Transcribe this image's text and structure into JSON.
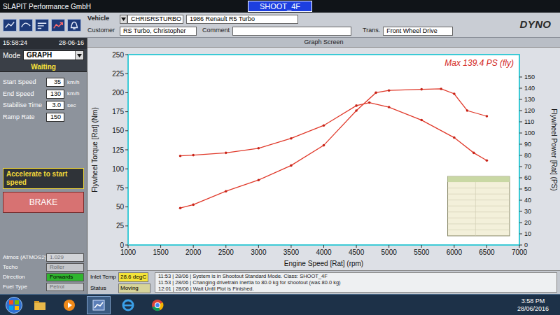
{
  "app": {
    "company": "SLAPIT Performance GmbH",
    "test": "SHOOT_4F",
    "logo": "DYNO"
  },
  "vehicle": {
    "vehicle_label": "Vehicle",
    "vehicle_id": "CHRISRSTURBO",
    "vehicle_name": "1986 Renault R5 Turbo",
    "customer_label": "Customer",
    "customer": "RS Turbo, Christopher",
    "comment_label": "Comment",
    "trans_label": "Trans.",
    "trans": "Front Wheel Drive"
  },
  "control": {
    "time": "15:58:24",
    "date": "28-06-16",
    "mode_label": "Mode",
    "mode": "GRAPH",
    "state": "Waiting",
    "settings": [
      {
        "label": "Start Speed",
        "value": "35",
        "unit": "km/h"
      },
      {
        "label": "End Speed",
        "value": "130",
        "unit": "km/h"
      },
      {
        "label": "Stabilise Time",
        "value": "3.0",
        "unit": "sec"
      },
      {
        "label": "Ramp Rate",
        "value": "150",
        "unit": ""
      }
    ],
    "prompt": "Accelerate to start speed",
    "brake": "BRAKE",
    "info": [
      {
        "label": "Atmos (ATMOS2)",
        "value": "1.029",
        "color": "#d2d4d8"
      },
      {
        "label": "Techo",
        "value": "Roller",
        "color": "#c4c6ca"
      },
      {
        "label": "Direction",
        "value": "Forwards",
        "color": "#2fb52f"
      },
      {
        "label": "Fuel Type",
        "value": "Petrol",
        "color": "#c4c6ca"
      }
    ]
  },
  "chart": {
    "title": "Graph Screen",
    "y_left_title": "Flywheel Torque [Rat] (Nm)",
    "y_right_title": "Flywheel Power [Rat] (PS)",
    "x_title": "Engine Speed [Rat] (rpm)",
    "annotation": "Max 139.4 PS (fly)",
    "x_ticks": [
      "1000",
      "1500",
      "2000",
      "2500",
      "3000",
      "3500",
      "4000",
      "4500",
      "5000",
      "5500",
      "6000",
      "6500",
      "7000"
    ],
    "y_left_ticks": [
      "0",
      "25",
      "50",
      "75",
      "100",
      "125",
      "150",
      "175",
      "200",
      "225",
      "250"
    ],
    "y_right_ticks": [
      "0",
      "10",
      "20",
      "30",
      "40",
      "50",
      "60",
      "70",
      "80",
      "90",
      "100",
      "110",
      "120",
      "130",
      "140",
      "150"
    ],
    "series": [
      {
        "axis": "left",
        "rpm": [
          1800,
          2000,
          2500,
          3000,
          3500,
          4000,
          4500,
          4700,
          5000,
          5500,
          6000,
          6300,
          6500
        ],
        "values": [
          117,
          118,
          121,
          127,
          140,
          157,
          183,
          187,
          181,
          164,
          141,
          121,
          111
        ]
      },
      {
        "axis": "right",
        "rpm": [
          1800,
          2000,
          2500,
          3000,
          3500,
          4000,
          4500,
          4800,
          5000,
          5500,
          5800,
          6000,
          6200,
          6500
        ],
        "values": [
          33,
          36,
          48,
          58,
          71,
          89,
          120,
          136,
          138,
          139,
          139.4,
          135,
          120,
          115
        ]
      }
    ]
  },
  "status": {
    "inlet_label": "Inlet Temp",
    "inlet_value": "28.6 degC",
    "status_label": "Status",
    "status_value": "Moving",
    "log": [
      "11:53 | 28/06 | System is in Shootout Standard Mode. Class: SHOOT_4F",
      "11:53 | 28/06 | Changing drivetrain inertia to 80.0 kg for shootout (was 80.0 kg)",
      "12:01 | 28/06 | Wait Until Plot is Finished."
    ]
  },
  "taskbar": {
    "time": "3:58 PM",
    "date": "28/06/2016"
  }
}
